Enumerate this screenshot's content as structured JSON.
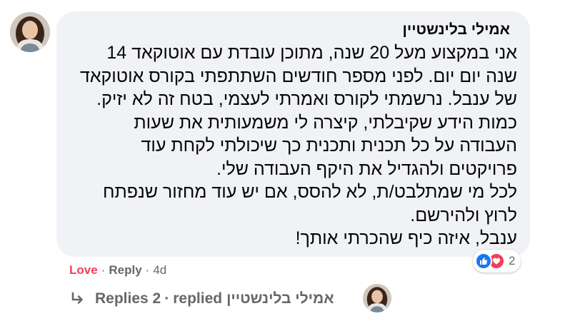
{
  "comment": {
    "author": "אמילי בלינשטיין",
    "lines": [
      "אני במקצוע מעל 20 שנה, מתוכן עובדת עם אוטוקאד 14",
      "שנה יום יום. לפני מספר חודשים השתתפתי בקורס אוטוקאד",
      "של ענבל. נרשמתי לקורס ואמרתי לעצמי, בטח זה לא יזיק.",
      "כמות הידע שקיבלתי, קיצרה לי משמעותית את שעות",
      "העבודה על כל תכנית ותכנית כך שיכולתי לקחת עוד",
      "פרויקטים ולהגדיל את היקף העבודה שלי.",
      "לכל מי שמתלבט/ת, לא להסס, אם יש עוד מחזור שנפתח",
      "לרוץ ולהירשם.",
      "ענבל, איזה כיף שהכרתי אותך!"
    ]
  },
  "reactions": {
    "icons": [
      "like-icon",
      "love-icon"
    ],
    "count": "2"
  },
  "actions": {
    "love": "Love",
    "sep": "·",
    "reply": "Reply",
    "time": "4d"
  },
  "replies": {
    "icon": "reply-arrow-icon",
    "label": "Replies 2",
    "sep": "·",
    "text": "replied",
    "author": "אמילי בלינשטיין"
  },
  "colors": {
    "bubble": "#f0f2f5",
    "love": "#f33e58",
    "like": "#1877f2",
    "muted": "#65676b"
  }
}
